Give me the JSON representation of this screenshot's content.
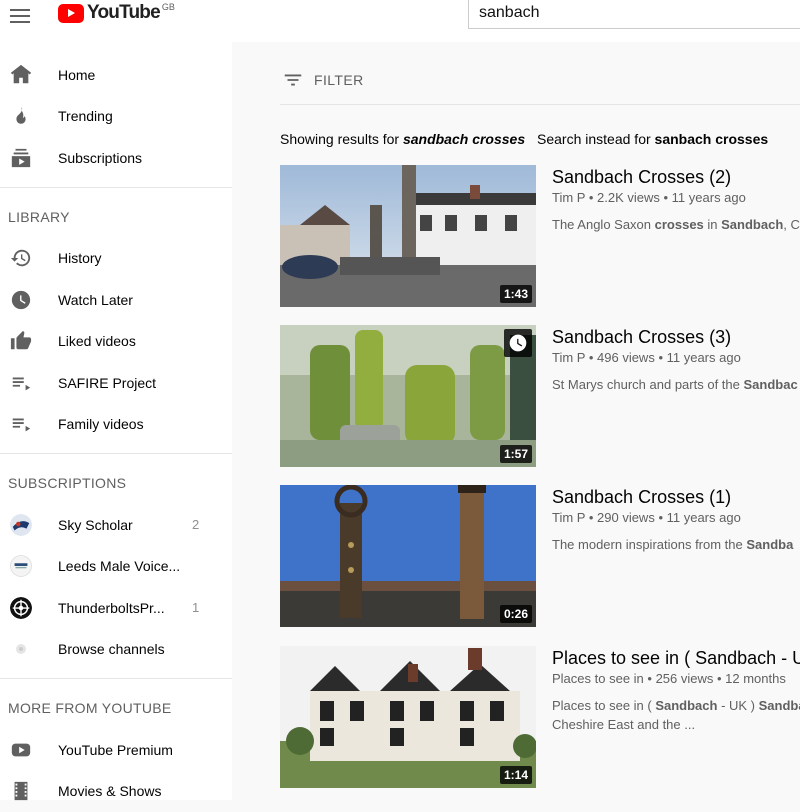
{
  "header": {
    "logo_text": "YouTube",
    "region": "GB",
    "search_value": "sanbach"
  },
  "sidebar": {
    "main_items": [
      {
        "label": "Home",
        "icon": "home-icon"
      },
      {
        "label": "Trending",
        "icon": "trending-icon"
      },
      {
        "label": "Subscriptions",
        "icon": "subscriptions-icon"
      }
    ],
    "library_heading": "LIBRARY",
    "library_items": [
      {
        "label": "History",
        "icon": "history-icon"
      },
      {
        "label": "Watch Later",
        "icon": "clock-icon"
      },
      {
        "label": "Liked videos",
        "icon": "thumbs-up-icon"
      },
      {
        "label": "SAFIRE Project",
        "icon": "playlist-icon"
      },
      {
        "label": "Family videos",
        "icon": "playlist-icon"
      }
    ],
    "subscriptions_heading": "SUBSCRIPTIONS",
    "subscriptions": [
      {
        "label": "Sky Scholar",
        "count": "2"
      },
      {
        "label": "Leeds Male Voice...",
        "count": ""
      },
      {
        "label": "ThunderboltsPr...",
        "count": "1"
      },
      {
        "label": "Browse channels",
        "count": ""
      }
    ],
    "more_heading": "MORE FROM YOUTUBE",
    "more_items": [
      {
        "label": "YouTube Premium",
        "icon": "youtube-icon"
      },
      {
        "label": "Movies & Shows",
        "icon": "film-icon"
      }
    ]
  },
  "main": {
    "filter_label": "FILTER",
    "showing_prefix": "Showing results for",
    "showing_term": "sandbach crosses",
    "instead_prefix": "Search instead for",
    "instead_term": "sanbach crosses",
    "results": [
      {
        "title": "Sandbach Crosses (2)",
        "channel": "Tim P",
        "views": "2.2K views",
        "age": "11 years ago",
        "duration": "1:43",
        "desc_parts": [
          "The Anglo Saxon ",
          "crosses",
          " in ",
          "Sandbach",
          ", Ch"
        ]
      },
      {
        "title": "Sandbach Crosses (3)",
        "channel": "Tim P",
        "views": "496 views",
        "age": "11 years ago",
        "duration": "1:57",
        "desc_parts": [
          "St Marys church and parts of the ",
          "Sandbac"
        ]
      },
      {
        "title": "Sandbach Crosses (1)",
        "channel": "Tim P",
        "views": "290 views",
        "age": "11 years ago",
        "duration": "0:26",
        "desc_parts": [
          "The modern inspirations from the ",
          "Sandba"
        ]
      },
      {
        "title": "Places to see in ( Sandbach - U",
        "channel": "Places to see in",
        "views": "256 views",
        "age": "12 months",
        "duration": "1:14",
        "desc_parts": [
          "Places to see in ( ",
          "Sandbach",
          " - UK ) ",
          "Sandba"
        ],
        "desc_line2": "Cheshire East and the ..."
      }
    ]
  }
}
